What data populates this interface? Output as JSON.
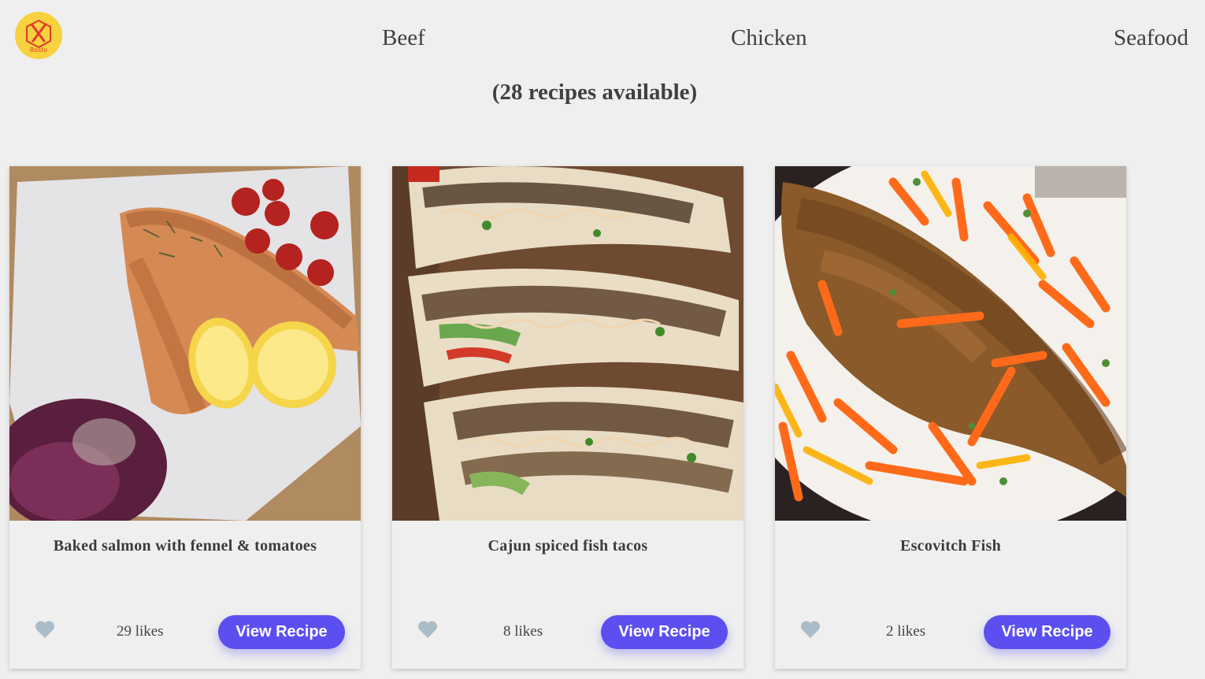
{
  "header": {
    "logo_text": "Rosto",
    "nav": [
      {
        "label": "Beef"
      },
      {
        "label": "Chicken"
      },
      {
        "label": "Seafood"
      }
    ]
  },
  "recipes_count_text": "(28 recipes available)",
  "colors": {
    "background": "#efefef",
    "accent": "#5b4ff0",
    "logo": "#f7d23e",
    "heart": "#a9bcc8"
  },
  "cards": [
    {
      "title": "Baked salmon with fennel & tomatoes",
      "likes": "29 likes",
      "button": "View Recipe",
      "liked_icon": "heart-icon"
    },
    {
      "title": "Cajun spiced fish tacos",
      "likes": "8 likes",
      "button": "View Recipe",
      "liked_icon": "heart-icon"
    },
    {
      "title": "Escovitch Fish",
      "likes": "2 likes",
      "button": "View Recipe",
      "liked_icon": "heart-icon"
    }
  ]
}
